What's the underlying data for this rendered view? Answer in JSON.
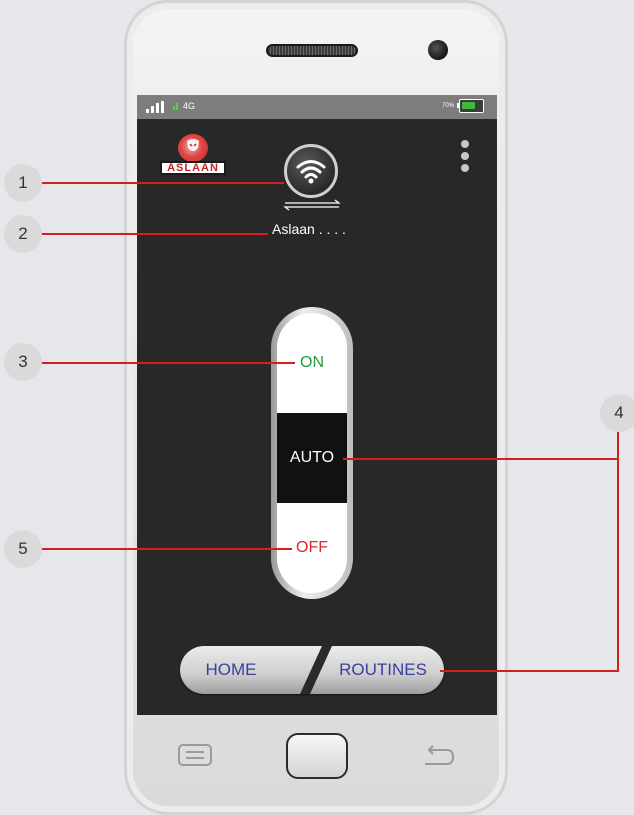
{
  "status_bar": {
    "network": "4G",
    "battery_percent": "70%",
    "battery_level": 0.7
  },
  "logo": {
    "text": "ASLAAN"
  },
  "device": {
    "name": "Aslaan . . . ."
  },
  "switch": {
    "on_label": "ON",
    "auto_label": "AUTO",
    "off_label": "OFF"
  },
  "nav": {
    "home_label": "HOME",
    "routines_label": "ROUTINES"
  },
  "callouts": [
    "1",
    "2",
    "3",
    "4",
    "5"
  ],
  "icons": [
    "signal-icon",
    "battery-icon",
    "lion-logo-icon",
    "more-vert-icon",
    "wifi-icon",
    "swap-arrows-icon",
    "menu-key-icon",
    "back-key-icon"
  ],
  "colors": {
    "screen_bg": "#282828",
    "on": "#1e9d3c",
    "off": "#e0282e",
    "nav_text": "#3a3fa0",
    "callout_line": "#d3201f"
  }
}
